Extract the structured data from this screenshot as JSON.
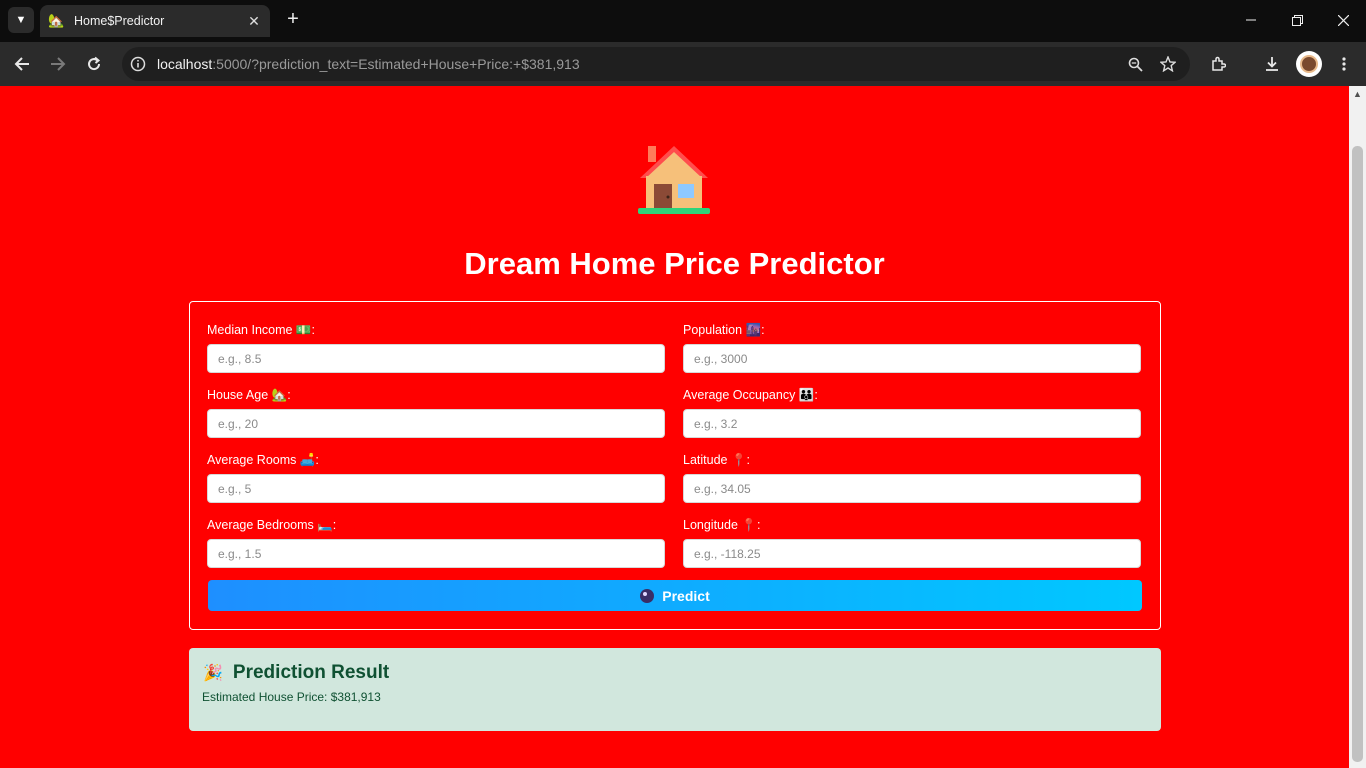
{
  "browser": {
    "tab_title": "Home$Predictor",
    "url_host": "localhost",
    "url_rest": ":5000/?prediction_text=Estimated+House+Price:+$381,913"
  },
  "page": {
    "title": "Dream Home Price Predictor",
    "hero_icon": "house-icon",
    "fields": {
      "median_income": {
        "label": "Median Income 💵:",
        "placeholder": "e.g., 8.5"
      },
      "population": {
        "label": "Population 🌆:",
        "placeholder": "e.g., 3000"
      },
      "house_age": {
        "label": "House Age 🏡:",
        "placeholder": "e.g., 20"
      },
      "average_occupancy": {
        "label": "Average Occupancy 👪:",
        "placeholder": "e.g., 3.2"
      },
      "average_rooms": {
        "label": "Average Rooms 🛋️:",
        "placeholder": "e.g., 5"
      },
      "latitude": {
        "label": "Latitude 📍:",
        "placeholder": "e.g., 34.05"
      },
      "average_bedrooms": {
        "label": "Average Bedrooms 🛏️:",
        "placeholder": "e.g., 1.5"
      },
      "longitude": {
        "label": "Longitude 📍:",
        "placeholder": "e.g., -118.25"
      }
    },
    "predict_button": "Predict",
    "result": {
      "title": "Prediction Result",
      "text": "Estimated House Price: $381,913"
    }
  },
  "colors": {
    "page_background": "#ff0000",
    "button_gradient_start": "#1e8fff",
    "button_gradient_end": "#00c8ff",
    "result_background": "#d1e7dd",
    "result_text": "#0f5132"
  }
}
